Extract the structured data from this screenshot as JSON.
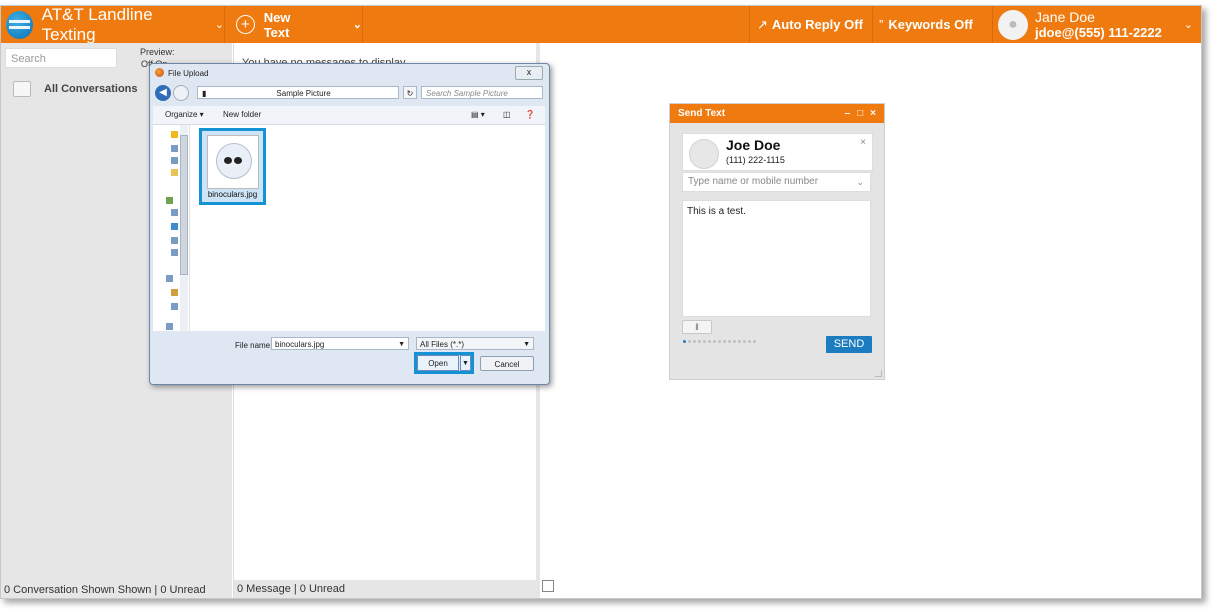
{
  "header": {
    "app_title": "AT&T Landline Texting",
    "new_text_label": "New Text",
    "auto_reply_label": "Auto Reply",
    "auto_reply_state": "Off",
    "keywords_label": "Keywords",
    "keywords_state": "Off",
    "user_name": "Jane Doe",
    "user_account": "jdoe@(555) 111-2222",
    "accent_color": "#ef7b10"
  },
  "sidebar": {
    "search_placeholder": "Search",
    "preview_label": "Preview:",
    "preview_options": "Off  On",
    "all_conversations": "All Conversations",
    "footer": "0 Conversation Shown Shown | 0 Unread"
  },
  "messages": {
    "empty_text": "You have no messages to display",
    "footer": "0 Message | 0 Unread"
  },
  "file_dialog": {
    "title": "File Upload",
    "path": "Sample Picture",
    "search_placeholder": "Search Sample Picture",
    "organize": "Organize ▾",
    "new_folder": "New folder",
    "file_item_name": "binoculars.jpg",
    "file_name_label": "File name:",
    "file_name_value": "binoculars.jpg",
    "file_type": "All Files (*.*)",
    "open_label": "Open",
    "cancel_label": "Cancel",
    "close_label": "x"
  },
  "send_text": {
    "title": "Send Text",
    "contact_name": "Joe Doe",
    "contact_number": "(111) 222-1115",
    "to_placeholder": "Type name or mobile number",
    "message": "This is a test.",
    "send_label": "SEND",
    "send_color": "#1c7cc0"
  }
}
